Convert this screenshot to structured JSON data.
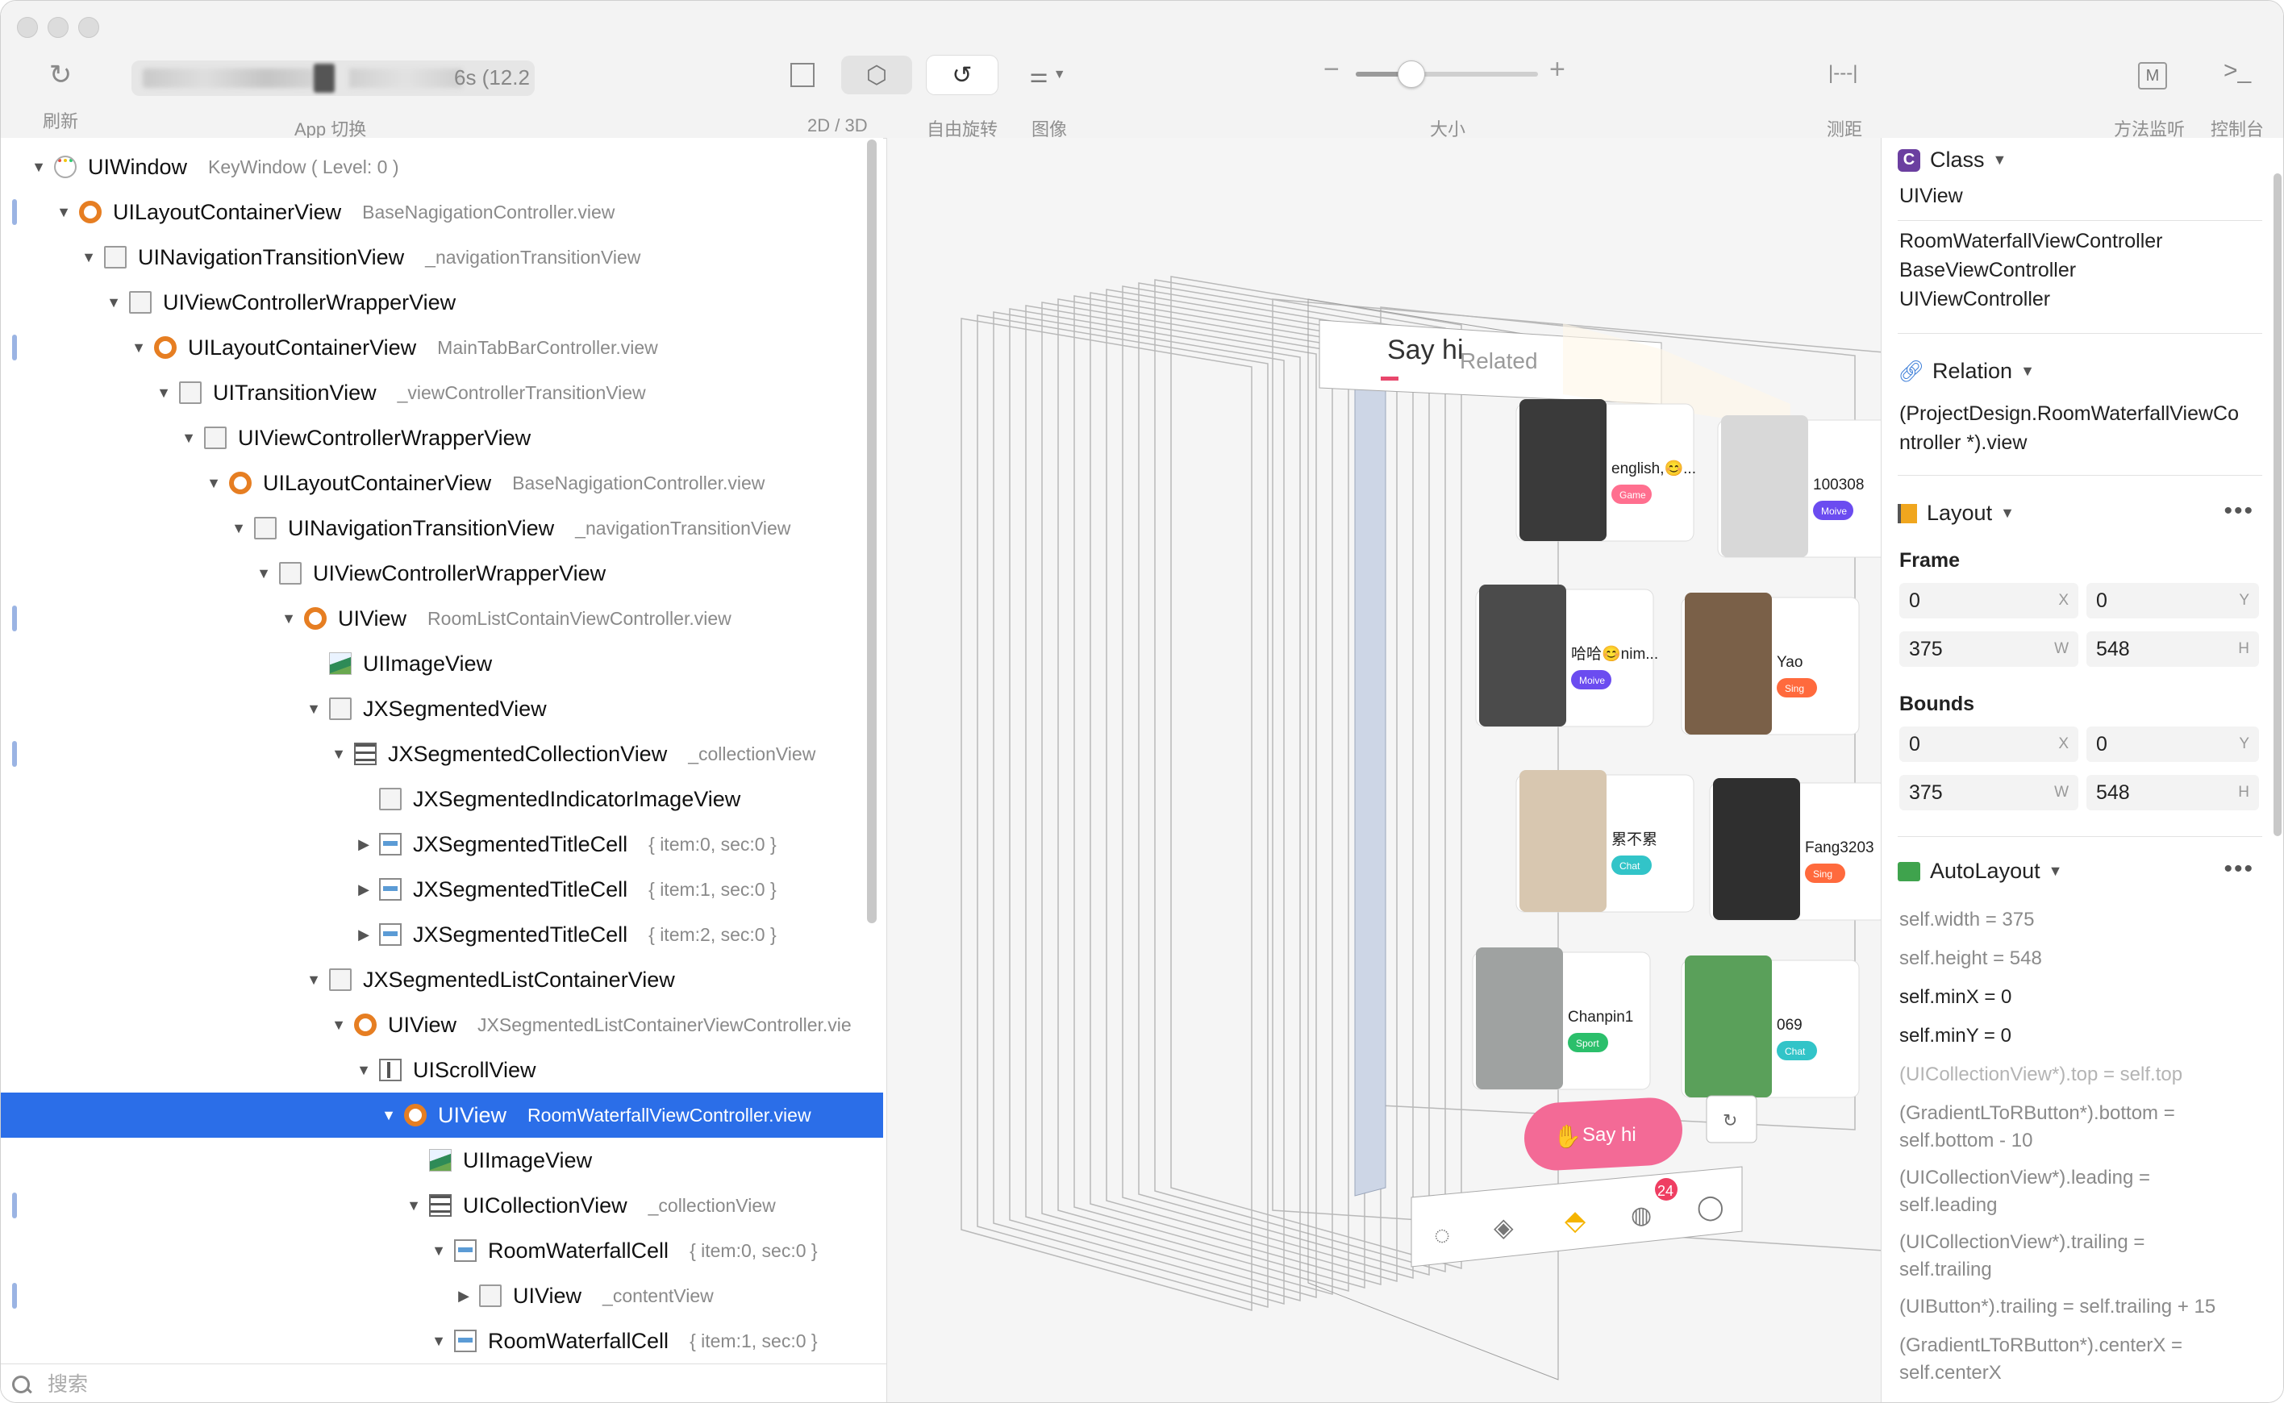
{
  "toolbar": {
    "refresh_label": "刷新",
    "app_switch_label": "App 切换",
    "app_switch_value": "6s (12.2",
    "view_mode_label": "2D / 3D",
    "rotate_label": "自由旋转",
    "image_label": "图像",
    "size_label": "大小",
    "measure_label": "测距",
    "method_monitor_label": "方法监听",
    "console_label": "控制台",
    "zoom_level": 0.3
  },
  "tree": {
    "rows": [
      {
        "name": "UIWindow",
        "sub": "KeyWindow ( Level: 0 )"
      },
      {
        "name": "UILayoutContainerView",
        "sub": "BaseNagigationController.view"
      },
      {
        "name": "UINavigationTransitionView",
        "sub": "_navigationTransitionView"
      },
      {
        "name": "UIViewControllerWrapperView",
        "sub": ""
      },
      {
        "name": "UILayoutContainerView",
        "sub": "MainTabBarController.view"
      },
      {
        "name": "UITransitionView",
        "sub": "_viewControllerTransitionView"
      },
      {
        "name": "UIViewControllerWrapperView",
        "sub": ""
      },
      {
        "name": "UILayoutContainerView",
        "sub": "BaseNagigationController.view"
      },
      {
        "name": "UINavigationTransitionView",
        "sub": "_navigationTransitionView"
      },
      {
        "name": "UIViewControllerWrapperView",
        "sub": ""
      },
      {
        "name": "UIView",
        "sub": "RoomListContainViewController.view"
      },
      {
        "name": "UIImageView",
        "sub": ""
      },
      {
        "name": "JXSegmentedView",
        "sub": ""
      },
      {
        "name": "JXSegmentedCollectionView",
        "sub": "_collectionView"
      },
      {
        "name": "JXSegmentedIndicatorImageView",
        "sub": ""
      },
      {
        "name": "JXSegmentedTitleCell",
        "sub": "{ item:0, sec:0 }"
      },
      {
        "name": "JXSegmentedTitleCell",
        "sub": "{ item:1, sec:0 }"
      },
      {
        "name": "JXSegmentedTitleCell",
        "sub": "{ item:2, sec:0 }"
      },
      {
        "name": "JXSegmentedListContainerView",
        "sub": ""
      },
      {
        "name": "UIView",
        "sub": "JXSegmentedListContainerViewController.vie"
      },
      {
        "name": "UIScrollView",
        "sub": ""
      },
      {
        "name": "UIView",
        "sub": "RoomWaterfallViewController.view"
      },
      {
        "name": "UIImageView",
        "sub": ""
      },
      {
        "name": "UICollectionView",
        "sub": "_collectionView"
      },
      {
        "name": "RoomWaterfallCell",
        "sub": "{ item:0, sec:0 }"
      },
      {
        "name": "UIView",
        "sub": "_contentView"
      },
      {
        "name": "RoomWaterfallCell",
        "sub": "{ item:1, sec:0 }"
      }
    ]
  },
  "search": {
    "placeholder": "搜索"
  },
  "canvas": {
    "tab_say_hi": "Say hi",
    "tab_related": "Related",
    "cards": [
      {
        "name": "english,😊...",
        "tag": "Game"
      },
      {
        "name": "100308",
        "tag": "Moive"
      },
      {
        "name": "哈哈😊nim...",
        "tag": "Moive"
      },
      {
        "name": "Yao",
        "tag": "Sing"
      },
      {
        "name": "累不累",
        "tag": "Chat"
      },
      {
        "name": "Fang3203",
        "tag": "Sing"
      },
      {
        "name": "Chanpin1",
        "tag": "Sport"
      },
      {
        "name": "069",
        "tag": "Chat"
      }
    ],
    "say_hi_button": "Say hi",
    "message_badge": "24"
  },
  "inspector": {
    "class_header": "Class",
    "class_name": "UIView",
    "class_chain": [
      "RoomWaterfallViewController",
      "BaseViewController",
      "UIViewController"
    ],
    "relation_header": "Relation",
    "relation_text_1": "(ProjectDesign.RoomWaterfallViewCo",
    "relation_text_2": "ntroller *).view",
    "layout_header": "Layout",
    "frame_label": "Frame",
    "bounds_label": "Bounds",
    "frame": {
      "x": "0",
      "y": "0",
      "w": "375",
      "h": "548"
    },
    "bounds": {
      "x": "0",
      "y": "0",
      "w": "375",
      "h": "548"
    },
    "units": {
      "x": "X",
      "y": "Y",
      "w": "W",
      "h": "H"
    },
    "autolayout_header": "AutoLayout",
    "constraints": [
      "self.width = 375",
      "self.height = 548",
      "self.minX = 0",
      "self.minY = 0",
      "(UICollectionView*).top = self.top",
      "(GradientLToRButton*).bottom =",
      "self.bottom - 10",
      "(UICollectionView*).leading =",
      "self.leading",
      "(UICollectionView*).trailing =",
      "self.trailing",
      "(UIButton*).trailing = self.trailing + 15",
      "(GradientLToRButton*).centerX =",
      "self.centerX"
    ]
  }
}
